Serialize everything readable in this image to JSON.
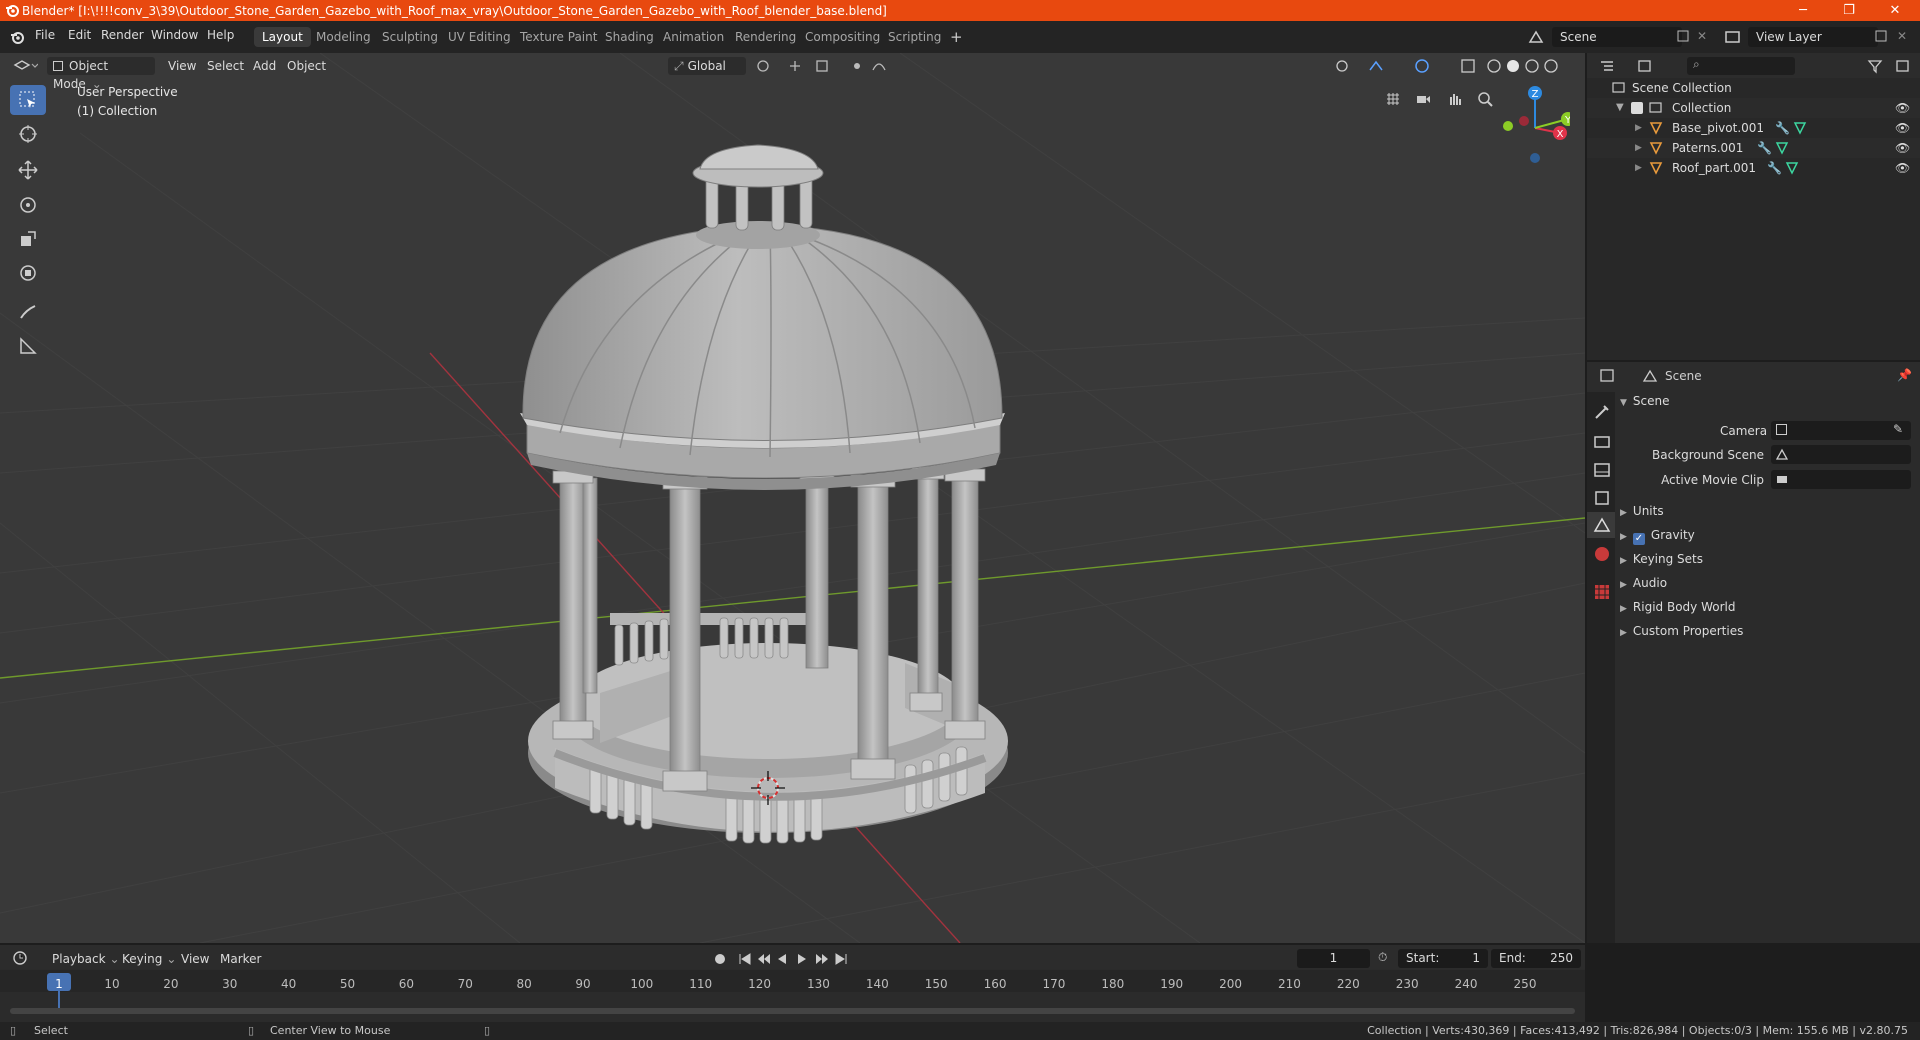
{
  "titlebar": {
    "title": "Blender* [I:\\!!!!conv_3\\39\\Outdoor_Stone_Garden_Gazebo_with_Roof_max_vray\\Outdoor_Stone_Garden_Gazebo_with_Roof_blender_base.blend]",
    "minimize": "─",
    "maximize": "❐",
    "close": "✕"
  },
  "menubar": {
    "items": [
      "File",
      "Edit",
      "Render",
      "Window",
      "Help"
    ],
    "workspaces": [
      "Layout",
      "Modeling",
      "Sculpting",
      "UV Editing",
      "Texture Paint",
      "Shading",
      "Animation",
      "Rendering",
      "Compositing",
      "Scripting"
    ],
    "active_workspace": "Layout",
    "add_tab": "+",
    "scene": "Scene",
    "view_layer": "View Layer"
  },
  "viewport_header": {
    "mode": "Object Mode",
    "menus": [
      "View",
      "Select",
      "Add",
      "Object"
    ],
    "orientation": "Global"
  },
  "viewport": {
    "perspective": "User Perspective",
    "collection": "(1) Collection",
    "gizmo_axes": [
      "Z",
      "X",
      "Y"
    ]
  },
  "outliner": {
    "root": "Scene Collection",
    "collection": "Collection",
    "objects": [
      "Base_pivot.001",
      "Paterns.001",
      "Roof_part.001"
    ]
  },
  "properties": {
    "header": "Scene",
    "panel_title": "Scene",
    "fields": [
      {
        "label": "Camera"
      },
      {
        "label": "Background Scene"
      },
      {
        "label": "Active Movie Clip"
      }
    ],
    "panels": [
      "Units",
      "Gravity",
      "Keying Sets",
      "Audio",
      "Rigid Body World",
      "Custom Properties"
    ]
  },
  "timeline": {
    "menus": [
      "Playback",
      "Keying",
      "View",
      "Marker"
    ],
    "current_frame": "1",
    "start_label": "Start:",
    "start": "1",
    "end_label": "End:",
    "end": "250",
    "ruler": [
      "1",
      "10",
      "20",
      "30",
      "40",
      "50",
      "60",
      "70",
      "80",
      "90",
      "100",
      "110",
      "120",
      "130",
      "140",
      "150",
      "160",
      "170",
      "180",
      "190",
      "200",
      "210",
      "220",
      "230",
      "240",
      "250"
    ]
  },
  "statusbar": {
    "select": "Select",
    "center_view": "Center View to Mouse",
    "stats": "Collection | Verts:430,369 | Faces:413,492 | Tris:826,984 | Objects:0/3 | Mem: 155.6 MB | v2.80.75"
  },
  "colors": {
    "titlebar": "#e8490f",
    "active_tool": "#4772b3",
    "axis_x": "#e0334a",
    "axis_y": "#8ccc26",
    "axis_z": "#2d8ae0"
  }
}
